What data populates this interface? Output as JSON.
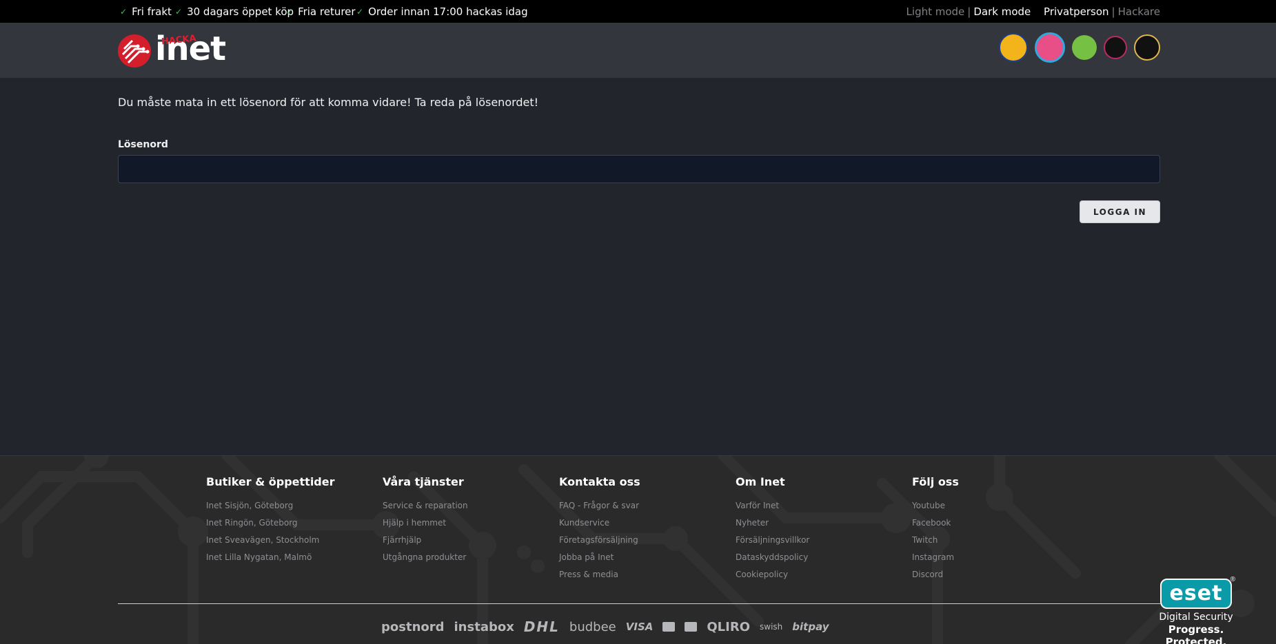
{
  "topbar": {
    "usps": [
      "Fri frakt",
      "30 dagars öppet köp",
      "Fria returer",
      "Order innan 17:00 hackas idag"
    ],
    "light_mode": "Light mode",
    "dark_mode": "Dark mode",
    "privatperson": "Privatperson",
    "hackare": "Hackare",
    "separator": "|"
  },
  "header": {
    "logo_text": "inet",
    "logo_tag": "HACKA"
  },
  "main": {
    "message": "Du måste mata in ett lösenord för att komma vidare! Ta reda på lösenordet!",
    "password_label": "Lösenord",
    "password_value": "",
    "login_label": "LOGGA IN"
  },
  "footer": {
    "columns": [
      {
        "title": "Butiker & öppettider",
        "links": [
          "Inet Sisjön, Göteborg",
          "Inet Ringön, Göteborg",
          "Inet Sveavägen, Stockholm",
          "Inet Lilla Nygatan, Malmö"
        ]
      },
      {
        "title": "Våra tjänster",
        "links": [
          "Service & reparation",
          "Hjälp i hemmet",
          "Fjärrhjälp",
          "Utgångna produkter"
        ]
      },
      {
        "title": "Kontakta oss",
        "links": [
          "FAQ - Frågor & svar",
          "Kundservice",
          "Företagsförsäljning",
          "Jobba på Inet",
          "Press & media"
        ]
      },
      {
        "title": "Om Inet",
        "links": [
          "Varför Inet",
          "Nyheter",
          "Försäljningsvillkor",
          "Dataskyddspolicy",
          "Cookiepolicy"
        ]
      },
      {
        "title": "Följ oss",
        "links": [
          "Youtube",
          "Facebook",
          "Twitch",
          "Instagram",
          "Discord"
        ]
      }
    ],
    "payments": [
      "postnord",
      "instabox",
      "DHL",
      "budbee",
      "VISA",
      "QLIRO",
      "swish",
      "bitpay"
    ],
    "eset": {
      "logo": "eset",
      "line1": "Digital Security",
      "line2": "Progress. Protected."
    }
  },
  "colors": {
    "accent": "#d41e2c",
    "check": "#37c35a",
    "background": "#22252b",
    "header": "#33363c",
    "footer": "#2a2a2a"
  }
}
